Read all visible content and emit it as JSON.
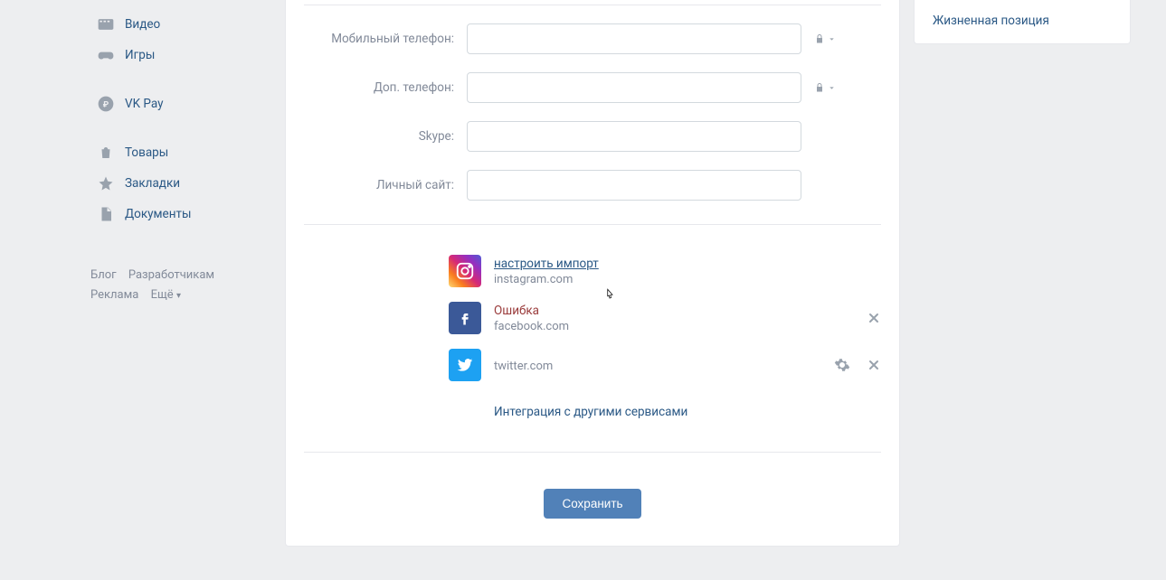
{
  "sidebar": {
    "items": [
      {
        "label": "Видео",
        "icon": "video-icon"
      },
      {
        "label": "Игры",
        "icon": "games-icon"
      },
      {
        "label": "VK Pay",
        "icon": "vkpay-icon"
      },
      {
        "label": "Товары",
        "icon": "shop-icon"
      },
      {
        "label": "Закладки",
        "icon": "star-icon"
      },
      {
        "label": "Документы",
        "icon": "document-icon"
      }
    ],
    "footer": {
      "blog": "Блог",
      "developers": "Разработчикам",
      "ads": "Реклама",
      "more": "Ещё"
    }
  },
  "form": {
    "mobile_label": "Мобильный телефон:",
    "mobile_value": "",
    "extra_label": "Доп. телефон:",
    "extra_value": "",
    "skype_label": "Skype:",
    "skype_value": "",
    "site_label": "Личный сайт:",
    "site_value": ""
  },
  "socials": {
    "instagram": {
      "title": "настроить импорт",
      "domain": "instagram.com"
    },
    "facebook": {
      "title": "Ошибка",
      "domain": "facebook.com"
    },
    "twitter": {
      "title": "",
      "domain": "twitter.com"
    },
    "more_link": "Интеграция с другими сервисами"
  },
  "buttons": {
    "save": "Сохранить"
  },
  "right": {
    "life_position": "Жизненная позиция"
  }
}
